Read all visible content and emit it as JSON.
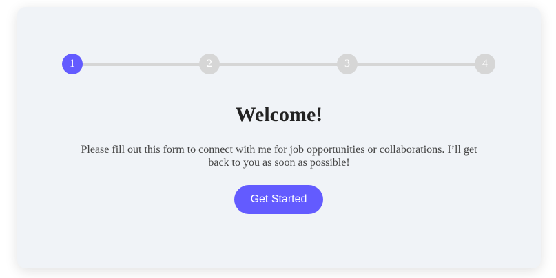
{
  "steps": [
    "1",
    "2",
    "3",
    "4"
  ],
  "active_step": 1,
  "title": "Welcome!",
  "description": "Please fill out this form to connect with me for job opportunities or collaborations. I’ll get back to you as soon as possible!",
  "button_label": "Get Started",
  "colors": {
    "accent": "#635bff",
    "inactive": "#d6d6d6",
    "card": "#f0f3f7"
  }
}
